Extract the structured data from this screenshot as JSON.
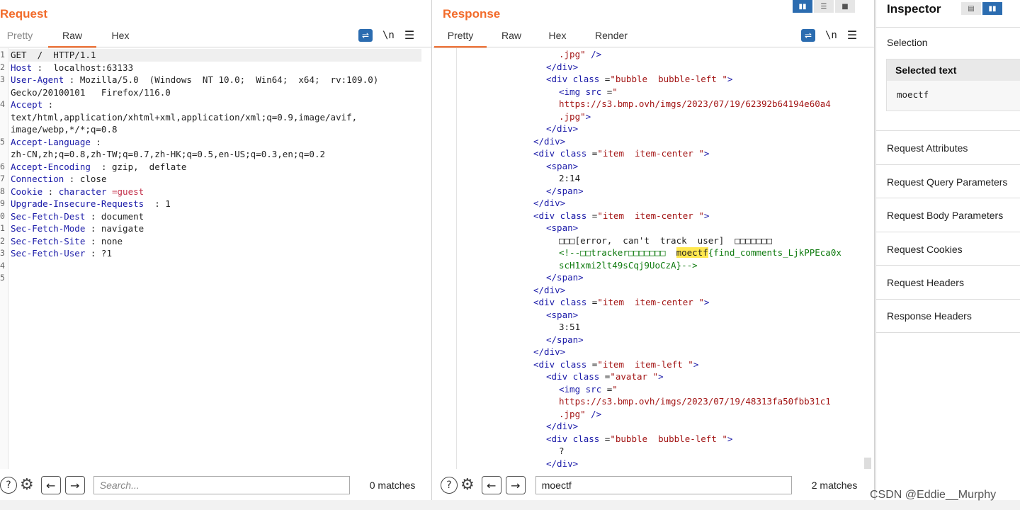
{
  "request": {
    "title": "Request",
    "tabs": [
      "Pretty",
      "Raw",
      "Hex"
    ],
    "active_tab": "Raw",
    "icons": {
      "wrap": "text-wrap-icon",
      "newline": "\\n",
      "menu": "☰"
    },
    "lines": [
      {
        "n": "1",
        "k": "",
        "v": "GET  /  HTTP/1.1"
      },
      {
        "n": "2",
        "k": "Host",
        "v": " :  localhost:63133"
      },
      {
        "n": "3",
        "k": "User-Agent",
        "v": " : Mozilla/5.0  (Windows  NT 10.0;  Win64;  x64;  rv:109.0)"
      },
      {
        "n": "",
        "k": "",
        "v": "Gecko/20100101   Firefox/116.0"
      },
      {
        "n": "4",
        "k": "Accept",
        "v": " :"
      },
      {
        "n": "",
        "k": "",
        "v": "text/html,application/xhtml+xml,application/xml;q=0.9,image/avif,"
      },
      {
        "n": "",
        "k": "",
        "v": "image/webp,*/*;q=0.8"
      },
      {
        "n": "5",
        "k": "Accept-Language",
        "v": " :"
      },
      {
        "n": "",
        "k": "",
        "v": "zh-CN,zh;q=0.8,zh-TW;q=0.7,zh-HK;q=0.5,en-US;q=0.3,en;q=0.2"
      },
      {
        "n": "6",
        "k": "Accept-Encoding",
        "v": "  : gzip,  deflate"
      },
      {
        "n": "7",
        "k": "Connection",
        "v": " : close"
      },
      {
        "n": "8",
        "k": "Cookie",
        "v": " : ",
        "k2": "character",
        "v2": " =guest"
      },
      {
        "n": "9",
        "k": "Upgrade-Insecure-Requests",
        "v": "  : 1"
      },
      {
        "n": "0",
        "k": "Sec-Fetch-Dest",
        "v": " : document"
      },
      {
        "n": "1",
        "k": "Sec-Fetch-Mode",
        "v": " : navigate"
      },
      {
        "n": "2",
        "k": "Sec-Fetch-Site",
        "v": " : none"
      },
      {
        "n": "3",
        "k": "Sec-Fetch-User",
        "v": " : ?1"
      },
      {
        "n": "4",
        "k": "",
        "v": ""
      },
      {
        "n": "5",
        "k": "",
        "v": ""
      }
    ],
    "search_placeholder": "Search...",
    "matches": "0 matches"
  },
  "response": {
    "title": "Response",
    "tabs": [
      "Pretty",
      "Raw",
      "Hex",
      "Render"
    ],
    "active_tab": "Pretty",
    "icons": {
      "wrap": "text-wrap-icon",
      "newline": "\\n",
      "menu": "☰"
    },
    "lines": [
      {
        "indent": 3,
        "parts": [
          [
            "str",
            ".jpg\" "
          ],
          [
            "tag",
            "/>"
          ]
        ]
      },
      {
        "indent": 2,
        "parts": [
          [
            "tag",
            "</div>"
          ]
        ]
      },
      {
        "indent": 2,
        "parts": [
          [
            "tag",
            "<div "
          ],
          [
            "attr",
            "class"
          ],
          [
            "txt",
            " ="
          ],
          [
            "str",
            "\"bubble  bubble-left \""
          ],
          [
            "tag",
            ">"
          ]
        ]
      },
      {
        "indent": 3,
        "parts": [
          [
            "tag",
            "<img "
          ],
          [
            "attr",
            "src"
          ],
          [
            "txt",
            " ="
          ],
          [
            "str",
            "\""
          ]
        ]
      },
      {
        "indent": 3,
        "parts": [
          [
            "str",
            "https://s3.bmp.ovh/imgs/2023/07/19/62392b64194e60a4"
          ]
        ]
      },
      {
        "indent": 3,
        "parts": [
          [
            "str",
            ".jpg\""
          ],
          [
            "tag",
            ">"
          ]
        ]
      },
      {
        "indent": 2,
        "parts": [
          [
            "tag",
            "</div>"
          ]
        ]
      },
      {
        "indent": 1,
        "parts": [
          [
            "tag",
            "</div>"
          ]
        ]
      },
      {
        "indent": 1,
        "parts": [
          [
            "tag",
            "<div "
          ],
          [
            "attr",
            "class"
          ],
          [
            "txt",
            " ="
          ],
          [
            "str",
            "\"item  item-center \""
          ],
          [
            "tag",
            ">"
          ]
        ]
      },
      {
        "indent": 2,
        "parts": [
          [
            "tag",
            "<span>"
          ]
        ]
      },
      {
        "indent": 3,
        "parts": [
          [
            "txt",
            "2:14"
          ]
        ]
      },
      {
        "indent": 2,
        "parts": [
          [
            "tag",
            "</span>"
          ]
        ]
      },
      {
        "indent": 1,
        "parts": [
          [
            "tag",
            "</div>"
          ]
        ]
      },
      {
        "indent": 1,
        "parts": [
          [
            "tag",
            "<div "
          ],
          [
            "attr",
            "class"
          ],
          [
            "txt",
            " ="
          ],
          [
            "str",
            "\"item  item-center \""
          ],
          [
            "tag",
            ">"
          ]
        ]
      },
      {
        "indent": 2,
        "parts": [
          [
            "tag",
            "<span>"
          ]
        ]
      },
      {
        "indent": 3,
        "parts": [
          [
            "txt",
            "□□□[error,  can't  track  user]  □□□□□□□"
          ]
        ]
      },
      {
        "indent": 3,
        "parts": [
          [
            "comment",
            "<!--□□tracker□□□□□□□  "
          ],
          [
            "mark",
            "moectf"
          ],
          [
            "comment",
            "{find_comments_LjkPPEca0x"
          ]
        ]
      },
      {
        "indent": 3,
        "parts": [
          [
            "comment",
            "scH1xmi2lt49sCqj9UoCzA}-->"
          ]
        ]
      },
      {
        "indent": 2,
        "parts": [
          [
            "tag",
            "</span>"
          ]
        ]
      },
      {
        "indent": 1,
        "parts": [
          [
            "tag",
            "</div>"
          ]
        ]
      },
      {
        "indent": 1,
        "parts": [
          [
            "tag",
            "<div "
          ],
          [
            "attr",
            "class"
          ],
          [
            "txt",
            " ="
          ],
          [
            "str",
            "\"item  item-center \""
          ],
          [
            "tag",
            ">"
          ]
        ]
      },
      {
        "indent": 2,
        "parts": [
          [
            "tag",
            "<span>"
          ]
        ]
      },
      {
        "indent": 3,
        "parts": [
          [
            "txt",
            "3:51"
          ]
        ]
      },
      {
        "indent": 2,
        "parts": [
          [
            "tag",
            "</span>"
          ]
        ]
      },
      {
        "indent": 1,
        "parts": [
          [
            "tag",
            "</div>"
          ]
        ]
      },
      {
        "indent": 1,
        "parts": [
          [
            "tag",
            "<div "
          ],
          [
            "attr",
            "class"
          ],
          [
            "txt",
            " ="
          ],
          [
            "str",
            "\"item  item-left \""
          ],
          [
            "tag",
            ">"
          ]
        ]
      },
      {
        "indent": 2,
        "parts": [
          [
            "tag",
            "<div "
          ],
          [
            "attr",
            "class"
          ],
          [
            "txt",
            " ="
          ],
          [
            "str",
            "\"avatar \""
          ],
          [
            "tag",
            ">"
          ]
        ]
      },
      {
        "indent": 3,
        "parts": [
          [
            "tag",
            "<img "
          ],
          [
            "attr",
            "src"
          ],
          [
            "txt",
            " ="
          ],
          [
            "str",
            "\""
          ]
        ]
      },
      {
        "indent": 3,
        "parts": [
          [
            "str",
            "https://s3.bmp.ovh/imgs/2023/07/19/48313fa50fbb31c1"
          ]
        ]
      },
      {
        "indent": 3,
        "parts": [
          [
            "str",
            ".jpg\" "
          ],
          [
            "tag",
            "/>"
          ]
        ]
      },
      {
        "indent": 2,
        "parts": [
          [
            "tag",
            "</div>"
          ]
        ]
      },
      {
        "indent": 2,
        "parts": [
          [
            "tag",
            "<div "
          ],
          [
            "attr",
            "class"
          ],
          [
            "txt",
            " ="
          ],
          [
            "str",
            "\"bubble  bubble-left \""
          ],
          [
            "tag",
            ">"
          ]
        ]
      },
      {
        "indent": 3,
        "parts": [
          [
            "txt",
            "?"
          ]
        ]
      },
      {
        "indent": 2,
        "parts": [
          [
            "tag",
            "</div>"
          ]
        ]
      }
    ],
    "search_value": "moectf",
    "matches": "2 matches"
  },
  "inspector": {
    "title": "Inspector",
    "selection_label": "Selection",
    "selected_text_label": "Selected text",
    "selected_text_value": "moectf",
    "sections": [
      "Request Attributes",
      "Request Query Parameters",
      "Request Body Parameters",
      "Request Cookies",
      "Request Headers",
      "Response Headers"
    ]
  },
  "watermark": "CSDN @Eddie__Murphy",
  "colors": {
    "accent": "#f26b2a",
    "button_blue": "#2b6cb0",
    "highlight": "#ffe84f"
  }
}
